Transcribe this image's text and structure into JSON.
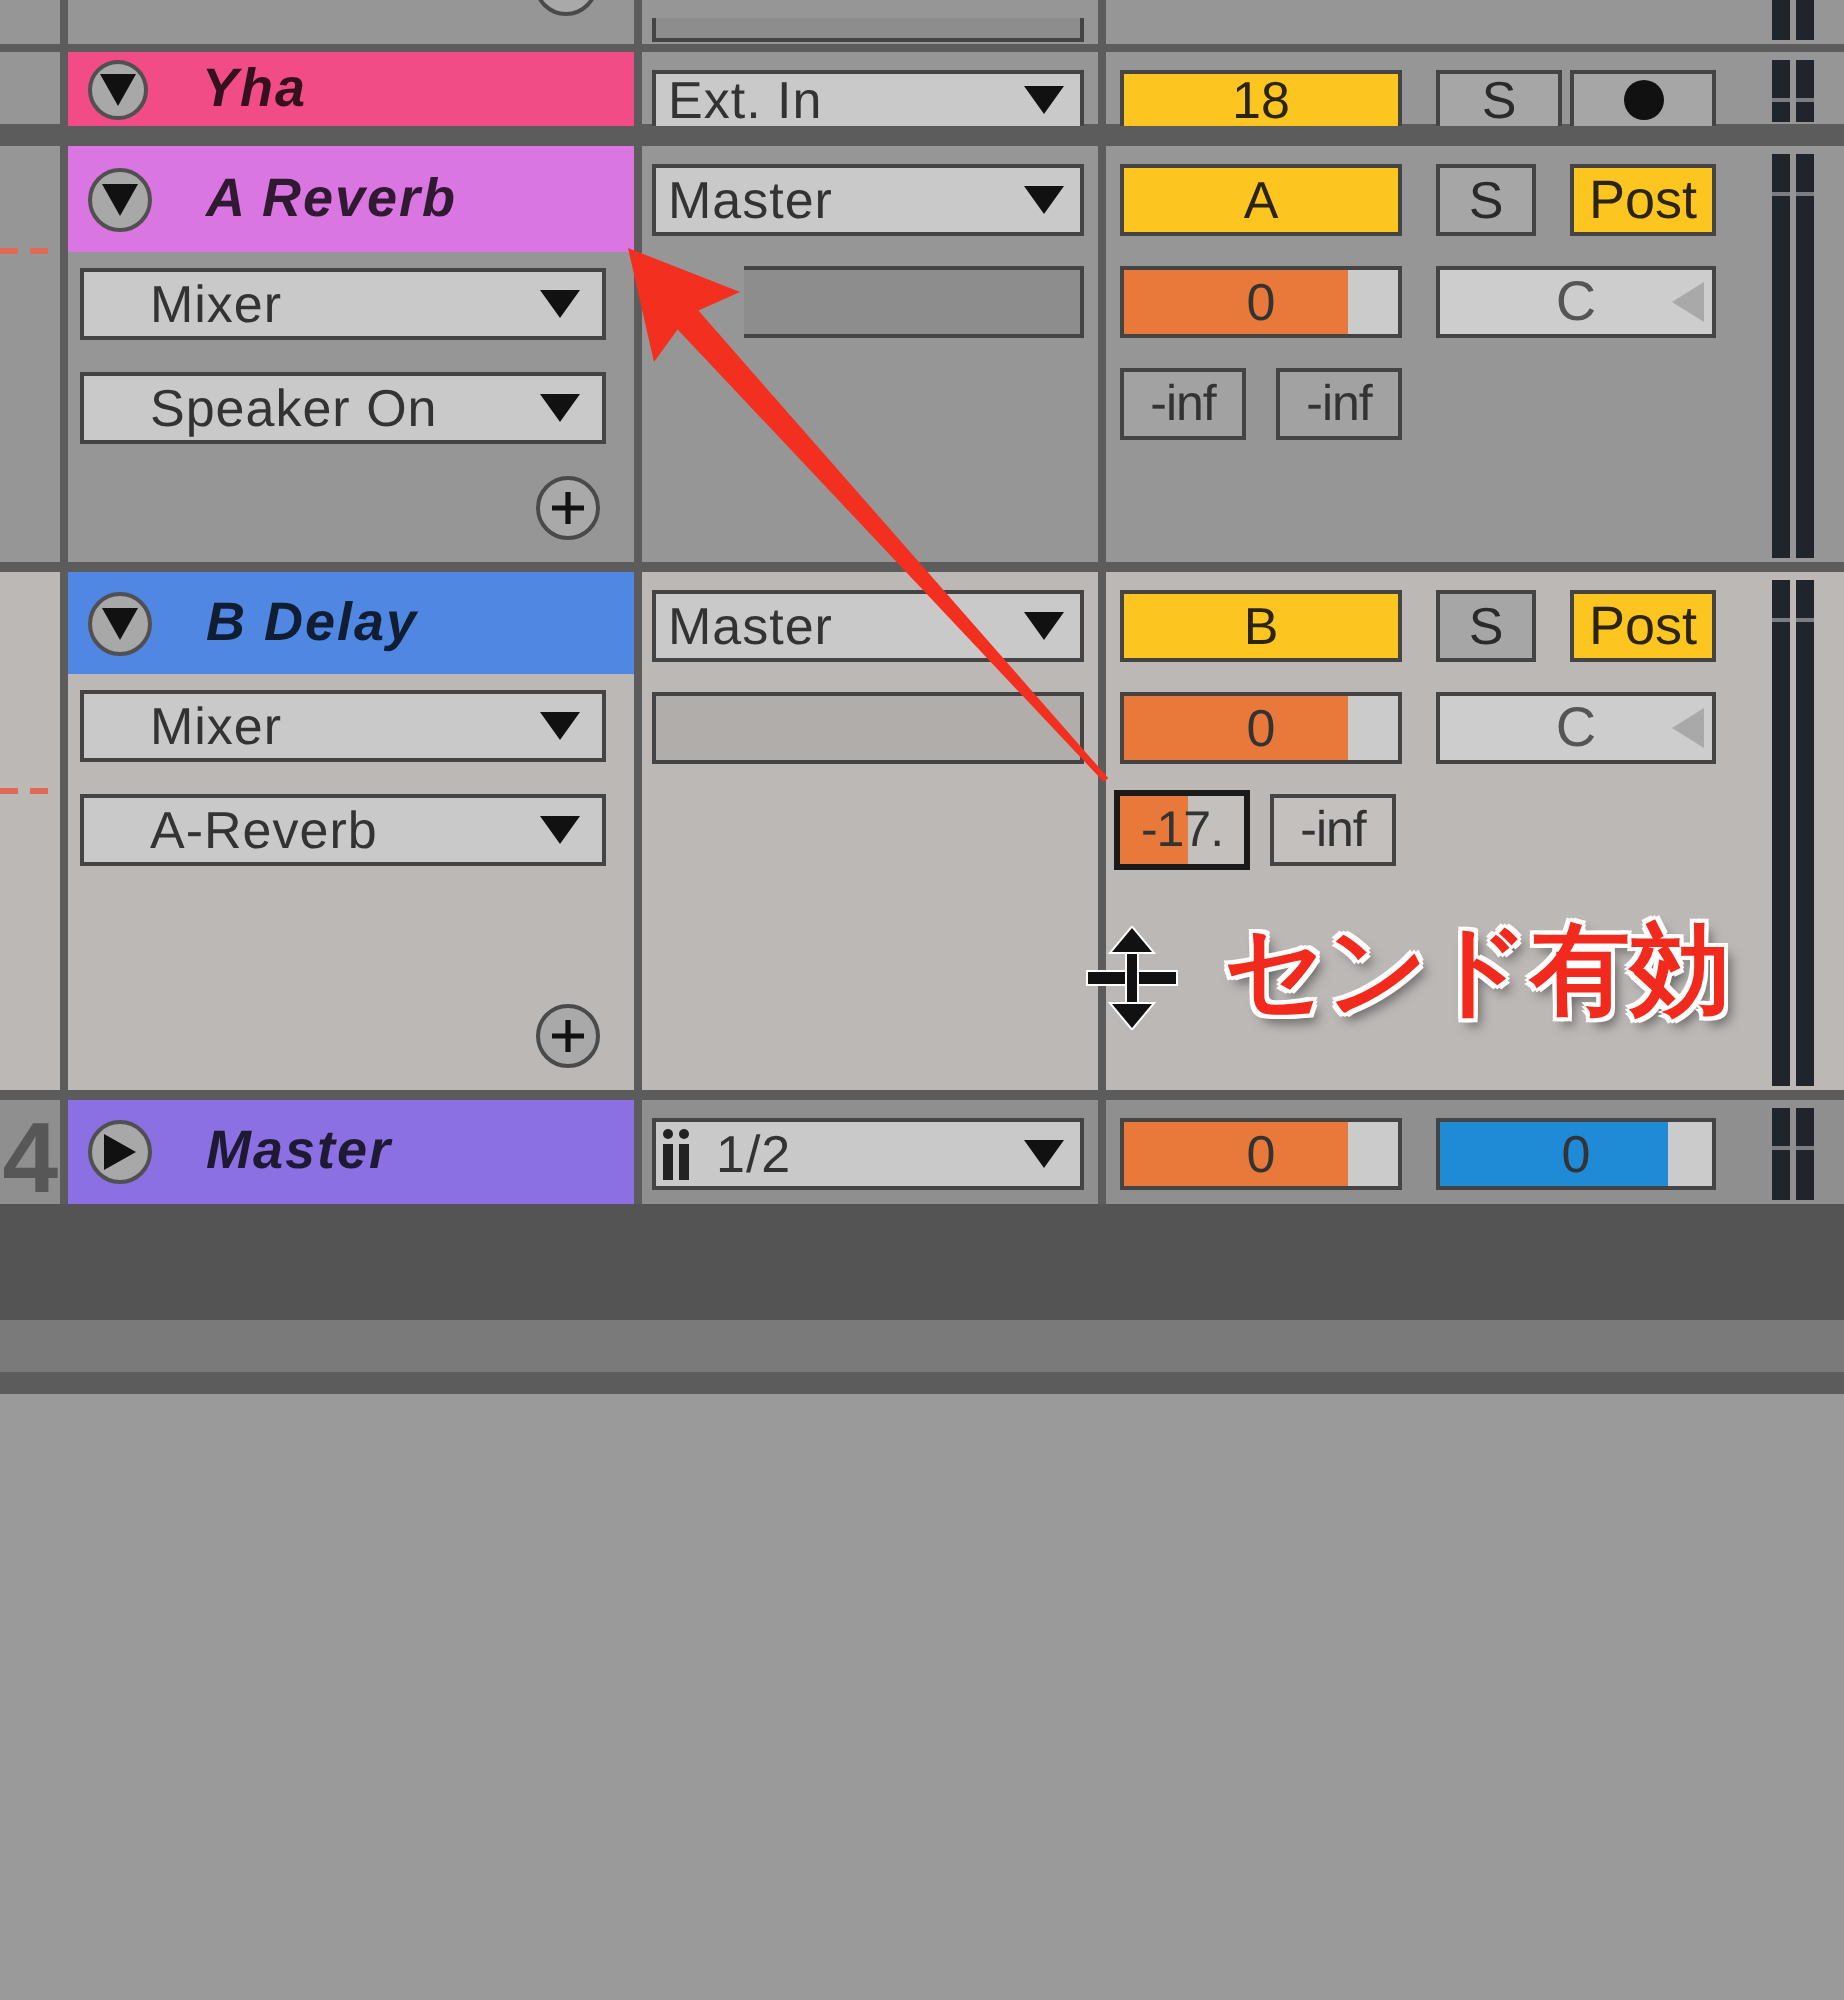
{
  "tracks": [
    {
      "name": "Yha",
      "color": "#f24c86",
      "expanded": true,
      "selected": false,
      "guide_line": false,
      "io": [
        {
          "kind": "dropdown",
          "value": "Ext. In"
        }
      ],
      "mixer": {
        "activator": {
          "label": "18",
          "on": true
        },
        "solo": {
          "label": "S",
          "on": false
        },
        "arm": {
          "armed": false
        }
      }
    },
    {
      "name": "A Reverb",
      "color": "#da76e2",
      "expanded": true,
      "selected": false,
      "guide_line": true,
      "devices": [
        {
          "value": "Mixer"
        },
        {
          "value": "Speaker On"
        }
      ],
      "io": [
        {
          "kind": "dropdown",
          "value": "Master"
        },
        {
          "kind": "blank"
        }
      ],
      "mixer": {
        "activator": {
          "label": "A",
          "on": true
        },
        "solo": {
          "label": "S",
          "on": false
        },
        "post": {
          "label": "Post",
          "on": true
        },
        "volume": {
          "value": "0",
          "level": 0.82
        },
        "pan": {
          "value": "C"
        },
        "sends": [
          {
            "value": "-inf",
            "selected": false
          },
          {
            "value": "-inf",
            "selected": false
          }
        ]
      }
    },
    {
      "name": "B Delay",
      "color": "#4f87e3",
      "expanded": true,
      "selected": true,
      "guide_line": true,
      "devices": [
        {
          "value": "Mixer"
        },
        {
          "value": "A-Reverb"
        }
      ],
      "io": [
        {
          "kind": "dropdown",
          "value": "Master"
        },
        {
          "kind": "blank"
        }
      ],
      "mixer": {
        "activator": {
          "label": "B",
          "on": true
        },
        "solo": {
          "label": "S",
          "on": false
        },
        "post": {
          "label": "Post",
          "on": true
        },
        "volume": {
          "value": "0",
          "level": 0.82
        },
        "pan": {
          "value": "C"
        },
        "sends": [
          {
            "value": "-17.",
            "level": 0.55,
            "selected": true
          },
          {
            "value": "-inf",
            "selected": false
          }
        ]
      }
    },
    {
      "number": "4",
      "name": "Master",
      "color": "#8b70e3",
      "expanded": false,
      "selected": false,
      "guide_line": false,
      "io": [
        {
          "kind": "stereo-dropdown",
          "value": "1/2"
        }
      ],
      "mixer": {
        "volume": {
          "value": "0",
          "level": 0.82
        },
        "cue": {
          "value": "0",
          "level": 0.84
        }
      }
    }
  ],
  "annotation": {
    "text": "センド有効"
  }
}
